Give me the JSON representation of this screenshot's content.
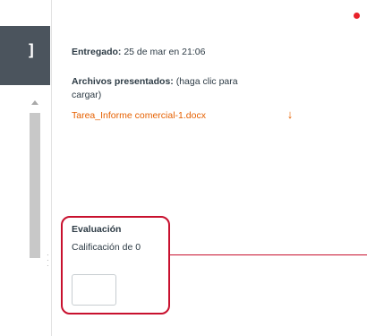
{
  "toolbar": {
    "expand_glyph": "]"
  },
  "submission": {
    "submitted_label": "Entregado:",
    "submitted_value": " 25 de mar en 21:06",
    "files_label": "Archivos presentados:",
    "files_hint": " (haga clic para cargar)",
    "file_name": "Tarea_Informe comercial-1.docx",
    "download_icon": "download-arrow-icon"
  },
  "evaluation": {
    "title": "Evaluación",
    "score_text": "Calificación de 0",
    "input_value": ""
  },
  "colors": {
    "accent": "#e66000",
    "highlight": "#c8102e",
    "text": "#2d3b45",
    "toolbar": "#4b545d"
  }
}
